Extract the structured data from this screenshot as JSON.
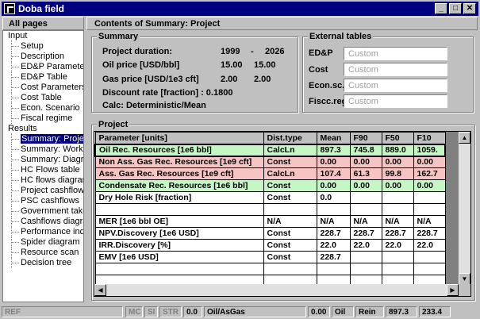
{
  "window": {
    "title": "Doba field",
    "minimize": "_",
    "maximize": "□",
    "close": "✕"
  },
  "left_panel": {
    "header": "All pages",
    "tree": [
      {
        "label": "Input",
        "level": 0
      },
      {
        "label": "Setup",
        "level": 1
      },
      {
        "label": "Description",
        "level": 1
      },
      {
        "label": "ED&P Paramete",
        "level": 1
      },
      {
        "label": "ED&P Table",
        "level": 1
      },
      {
        "label": "Cost Parameters",
        "level": 1
      },
      {
        "label": "Cost Table",
        "level": 1
      },
      {
        "label": "Econ. Scenario",
        "level": 1
      },
      {
        "label": "Fiscal regime",
        "level": 1
      },
      {
        "label": "Results",
        "level": 0
      },
      {
        "label": "Summary: Proje",
        "level": 1,
        "selected": true
      },
      {
        "label": "Summary: Work",
        "level": 1
      },
      {
        "label": "Summary: Diagr",
        "level": 1
      },
      {
        "label": "HC Flows table",
        "level": 1
      },
      {
        "label": "HC flows diagran",
        "level": 1
      },
      {
        "label": "Project cashflow",
        "level": 1
      },
      {
        "label": "PSC cashflows",
        "level": 1
      },
      {
        "label": "Government take",
        "level": 1
      },
      {
        "label": "Cashflows diagra",
        "level": 1
      },
      {
        "label": "Performance ind.",
        "level": 1
      },
      {
        "label": "Spider diagram",
        "level": 1
      },
      {
        "label": "Resource scan",
        "level": 1
      },
      {
        "label": "Decision tree",
        "level": 1
      }
    ]
  },
  "content": {
    "header": "Contents of Summary: Project",
    "summary": {
      "title": "Summary",
      "project_duration_label": "Project duration:",
      "project_start": "1999",
      "dash": "-",
      "project_end": "2026",
      "oil_price_label": "Oil price [USD/bbl]",
      "oil_price_1": "15.00",
      "oil_price_2": "15.00",
      "gas_price_label": "Gas price [USD/1e3 cft]",
      "gas_price_1": "2.00",
      "gas_price_2": "2.00",
      "discount_label": "Discount rate [fraction] : 0.1800",
      "calc_label": "Calc: Deterministic/Mean"
    },
    "external_tables": {
      "title": "External tables",
      "rows": [
        {
          "label": "ED&P",
          "value": "Custom"
        },
        {
          "label": "Cost",
          "value": "Custom"
        },
        {
          "label": "Econ.sc.",
          "value": "Custom"
        },
        {
          "label": "Fiscc.reg.",
          "value": "Custom"
        }
      ]
    },
    "project": {
      "title": "Project",
      "columns": [
        "Parameter [units]",
        "Dist.type",
        "Mean",
        "F90",
        "F50",
        "F10"
      ],
      "rows": [
        {
          "cells": [
            "Oil Rec. Resources [1e6 bbl]",
            "CalcLn",
            "897.3",
            "745.8",
            "889.0",
            "1059."
          ],
          "color": "green",
          "current": true
        },
        {
          "cells": [
            "Non Ass. Gas Rec. Resources [1e9 cft]",
            "Const",
            "0.00",
            "0.00",
            "0.00",
            "0.00"
          ],
          "color": "red"
        },
        {
          "cells": [
            "Ass. Gas Rec. Resources [1e9 cft]",
            "CalcLn",
            "107.4",
            "61.3",
            "99.8",
            "162.7"
          ],
          "color": "red"
        },
        {
          "cells": [
            "Condensate Rec. Resources [1e6 bbl]",
            "Const",
            "0.00",
            "0.00",
            "0.00",
            "0.00"
          ],
          "color": "green"
        },
        {
          "cells": [
            "Dry Hole Risk [fraction]",
            "Const",
            "0.0",
            "",
            "",
            ""
          ],
          "color": ""
        },
        {
          "cells": [
            "",
            "",
            "",
            "",
            "",
            ""
          ],
          "color": ""
        },
        {
          "cells": [
            "MER [1e6 bbl OE]",
            "N/A",
            "N/A",
            "N/A",
            "N/A",
            "N/A"
          ],
          "color": ""
        },
        {
          "cells": [
            "NPV.Discovery [1e6 USD]",
            "Const",
            "228.7",
            "228.7",
            "228.7",
            "228.7"
          ],
          "color": ""
        },
        {
          "cells": [
            "IRR.Discovery [%]",
            "Const",
            "22.0",
            "22.0",
            "22.0",
            "22.0"
          ],
          "color": ""
        },
        {
          "cells": [
            "EMV [1e6 USD]",
            "Const",
            "228.7",
            "",
            "",
            ""
          ],
          "color": ""
        },
        {
          "cells": [
            "",
            "",
            "",
            "",
            "",
            ""
          ],
          "color": ""
        },
        {
          "cells": [
            "",
            "",
            "",
            "",
            "",
            ""
          ],
          "color": ""
        }
      ]
    }
  },
  "statusbar": {
    "ref": "REF",
    "mc": "MC",
    "si": "SI",
    "str": "STR",
    "v1": "0.0",
    "mode": "Oil/AsGas",
    "v2": "0.00",
    "fluid": "Oil",
    "rein": "Rein",
    "v3": "897.3",
    "v4": "233.4"
  }
}
